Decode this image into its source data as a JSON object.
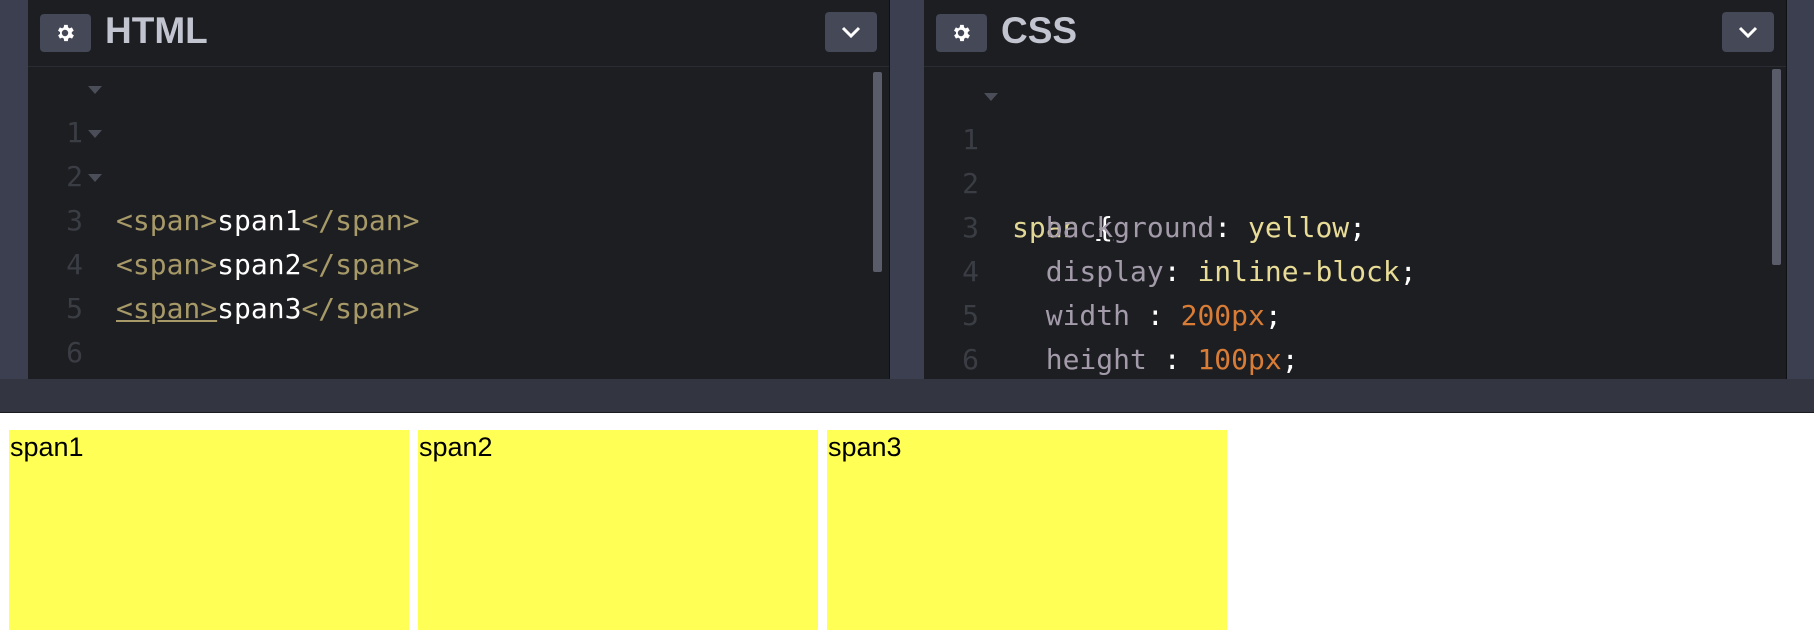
{
  "html_panel": {
    "title": "HTML",
    "lines": [
      {
        "num": "1",
        "open_tag": "<span>",
        "text": "span1",
        "close_tag": "</span>"
      },
      {
        "num": "2",
        "open_tag": "<span>",
        "text": "span2",
        "close_tag": "</span>"
      },
      {
        "num": "3",
        "open_tag": "<span>",
        "text": "span3",
        "close_tag": "</span>"
      },
      {
        "num": "4"
      },
      {
        "num": "5"
      },
      {
        "num": "6"
      }
    ]
  },
  "css_panel": {
    "title": "CSS",
    "selector": "span",
    "open_brace": "{",
    "close_brace": "}",
    "nums": [
      "1",
      "2",
      "3",
      "4",
      "5",
      "6"
    ],
    "declarations": [
      {
        "prop": "background",
        "sep": ": ",
        "value": "yellow",
        "end": ";"
      },
      {
        "prop": "display",
        "sep": ": ",
        "value": "inline-block",
        "end": ";"
      },
      {
        "prop": "width",
        "sep": " : ",
        "value": "200px",
        "end": ";"
      },
      {
        "prop": "height",
        "sep": " : ",
        "value": "100px",
        "end": ";"
      }
    ]
  },
  "preview": {
    "boxes": [
      "span1",
      "span2",
      "span3"
    ],
    "box_color": "#ffff55"
  },
  "icons": {
    "settings": "gear-icon",
    "collapse": "chevron-down-icon"
  }
}
